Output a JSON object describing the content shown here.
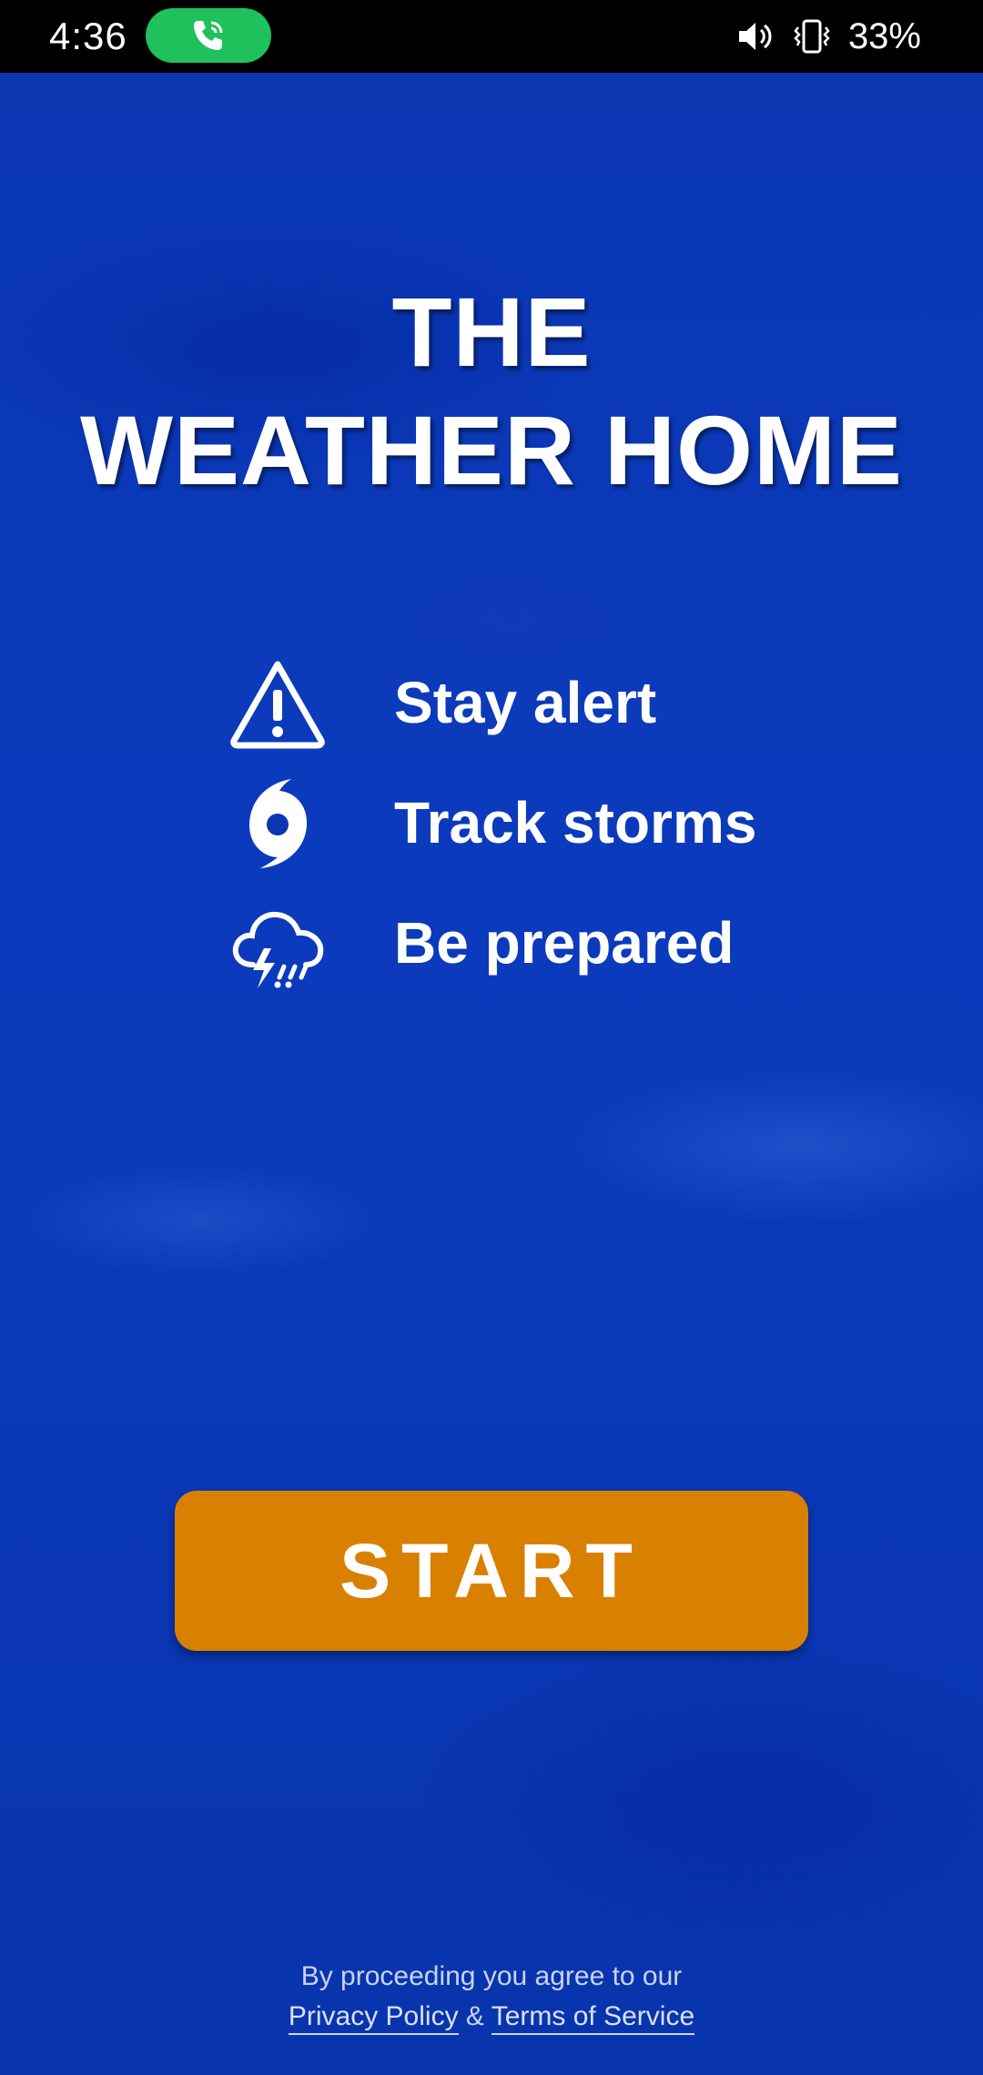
{
  "status_bar": {
    "time": "4:36",
    "battery": "33%",
    "icons": [
      "phone-call-icon",
      "volume-icon",
      "vibrate-icon"
    ],
    "call_pill_color": "#1ec15b"
  },
  "title": {
    "line1": "THE",
    "line2": "WEATHER HOME"
  },
  "features": [
    {
      "icon": "warning-icon",
      "label": "Stay alert"
    },
    {
      "icon": "hurricane-icon",
      "label": "Track storms"
    },
    {
      "icon": "thunderstorm-icon",
      "label": "Be prepared"
    }
  ],
  "start_button": {
    "label": "START",
    "color": "#d98000"
  },
  "legal": {
    "text": "By proceeding you agree to our",
    "privacy_link": "Privacy Policy",
    "separator": "&",
    "terms_link": "Terms of Service"
  },
  "colors": {
    "background": "#0a36b2",
    "text": "#ffffff"
  }
}
